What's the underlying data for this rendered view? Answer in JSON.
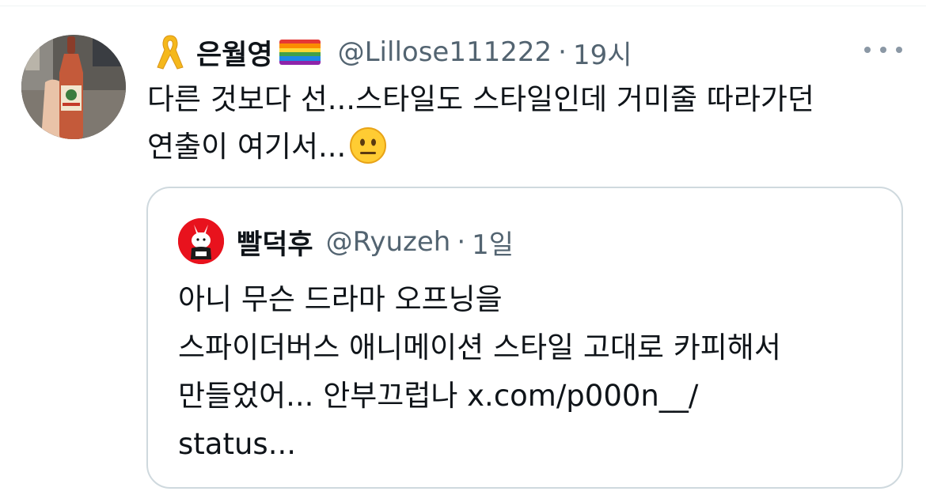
{
  "tweet": {
    "display_name": "은월영",
    "name_emoji_left": "yellow-ribbon-icon",
    "name_emoji_right": "rainbow-flag-icon",
    "handle": "@Lillose111222",
    "separator": "·",
    "time": "19시",
    "text_lines": [
      "다른 것보다 선...스타일도 스타일인데 거미줄 따라가던",
      "연출이 여기서..."
    ],
    "text_emoji": "neutral-face-icon"
  },
  "quote": {
    "display_name": "빨덕후",
    "handle": "@Ryuzeh",
    "separator": "·",
    "time": "1일",
    "text_lines": [
      "아니 무슨 드라마 오프닝을",
      "스파이더버스 애니메이션 스타일 고대로 카피해서",
      "만들었어... 안부끄럽나 x.com/p000n__/",
      "status..."
    ]
  },
  "colors": {
    "secondary_text": "#536471",
    "border": "#cfd9de",
    "quote_avatar_bg": "#e8121d"
  }
}
